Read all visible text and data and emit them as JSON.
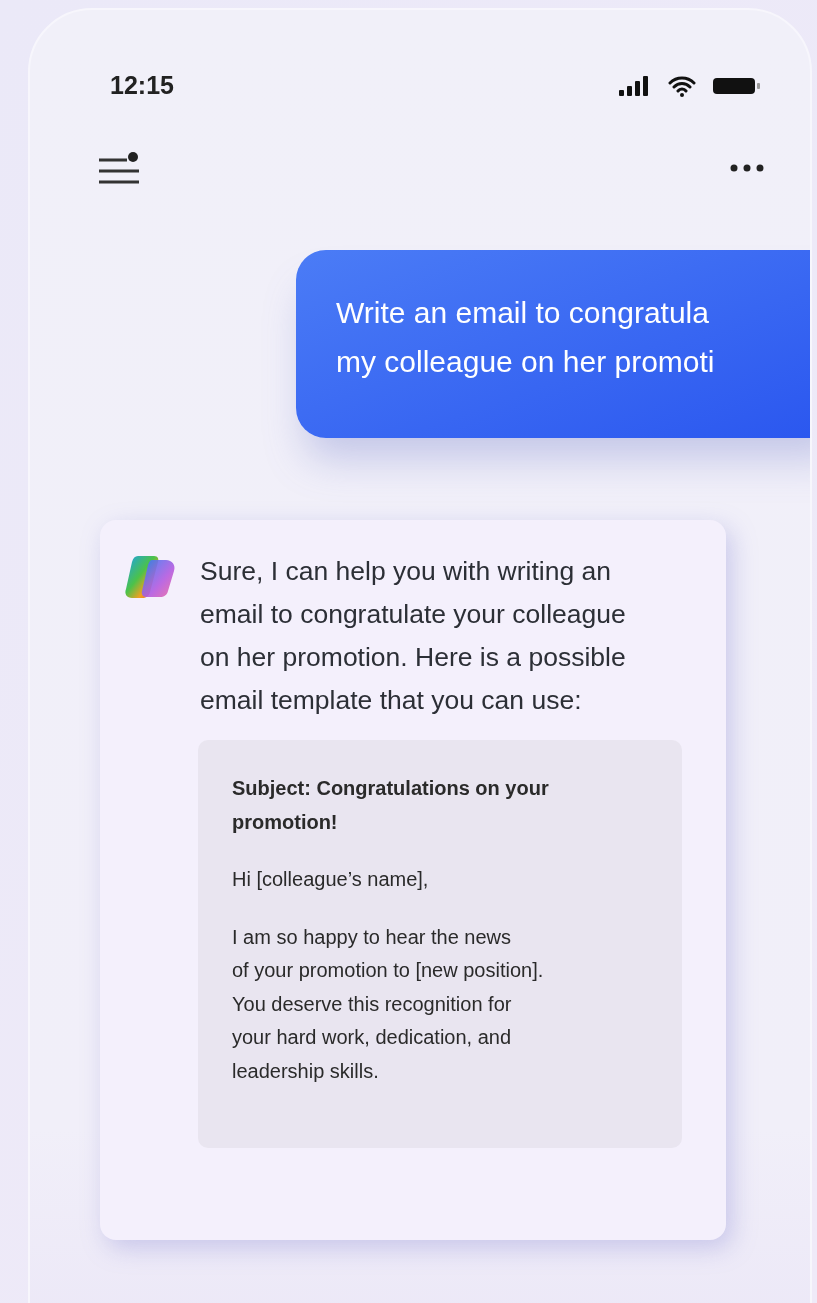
{
  "status_bar": {
    "time": "12:15"
  },
  "user_message": {
    "lines": [
      "Write an email to congratula",
      "my colleague on her promoti"
    ]
  },
  "assistant_message": {
    "text": "Sure, I can help you with writing an email to congratulate your colleague on her promotion. Here is a possible email template that you can use:",
    "email": {
      "subject": "Subject: Congratulations on your promotion!",
      "greeting": "Hi [colleague’s name],",
      "body_lines": [
        "I am so happy to hear the news",
        "of your promotion to [new position].",
        "You deserve this recognition for",
        "your hard work, dedication, and",
        "leadership skills."
      ]
    }
  }
}
